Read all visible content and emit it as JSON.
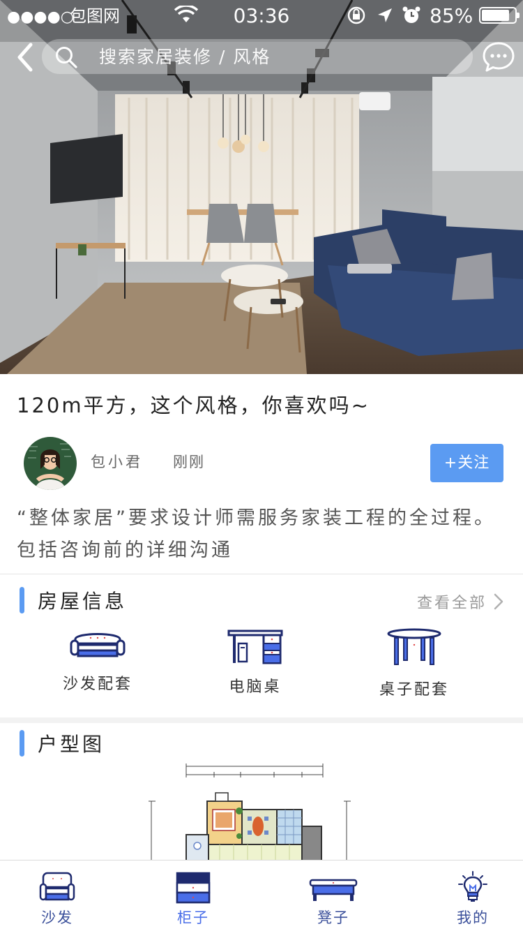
{
  "status_bar": {
    "signal": "●●●●○",
    "carrier": "包图网",
    "time": "03:36",
    "battery": "85%",
    "battery_level": 0.85
  },
  "header": {
    "search_placeholder": "搜索家居装修 / 风格",
    "icons": [
      "chevron-left-icon",
      "search-icon",
      "chat-bubble-icon"
    ]
  },
  "post": {
    "title": "120m平方，这个风格，你喜欢吗~",
    "author": "包小君",
    "time": "刚刚",
    "follow_label": "+关注",
    "body": "“整体家居”要求设计师需服务家装工程的全过程。包括咨询前的详细沟通"
  },
  "house_info": {
    "title": "房屋信息",
    "view_all": "查看全部",
    "items": [
      {
        "label": "沙发配套",
        "icon": "sofa-icon"
      },
      {
        "label": "电脑桌",
        "icon": "computer-desk-icon"
      },
      {
        "label": "桌子配套",
        "icon": "round-table-icon"
      }
    ]
  },
  "floor_plan": {
    "title": "户型图"
  },
  "tabbar": {
    "active": 1,
    "tabs": [
      {
        "label": "沙发",
        "icon": "sofa-icon"
      },
      {
        "label": "柜子",
        "icon": "cabinet-icon"
      },
      {
        "label": "凳子",
        "icon": "bench-icon"
      },
      {
        "label": "我的",
        "icon": "lightbulb-icon"
      }
    ]
  },
  "colors": {
    "accent": "#5b9bf2",
    "icon_navy": "#1e2a6e",
    "icon_blue": "#4a6ee8"
  }
}
